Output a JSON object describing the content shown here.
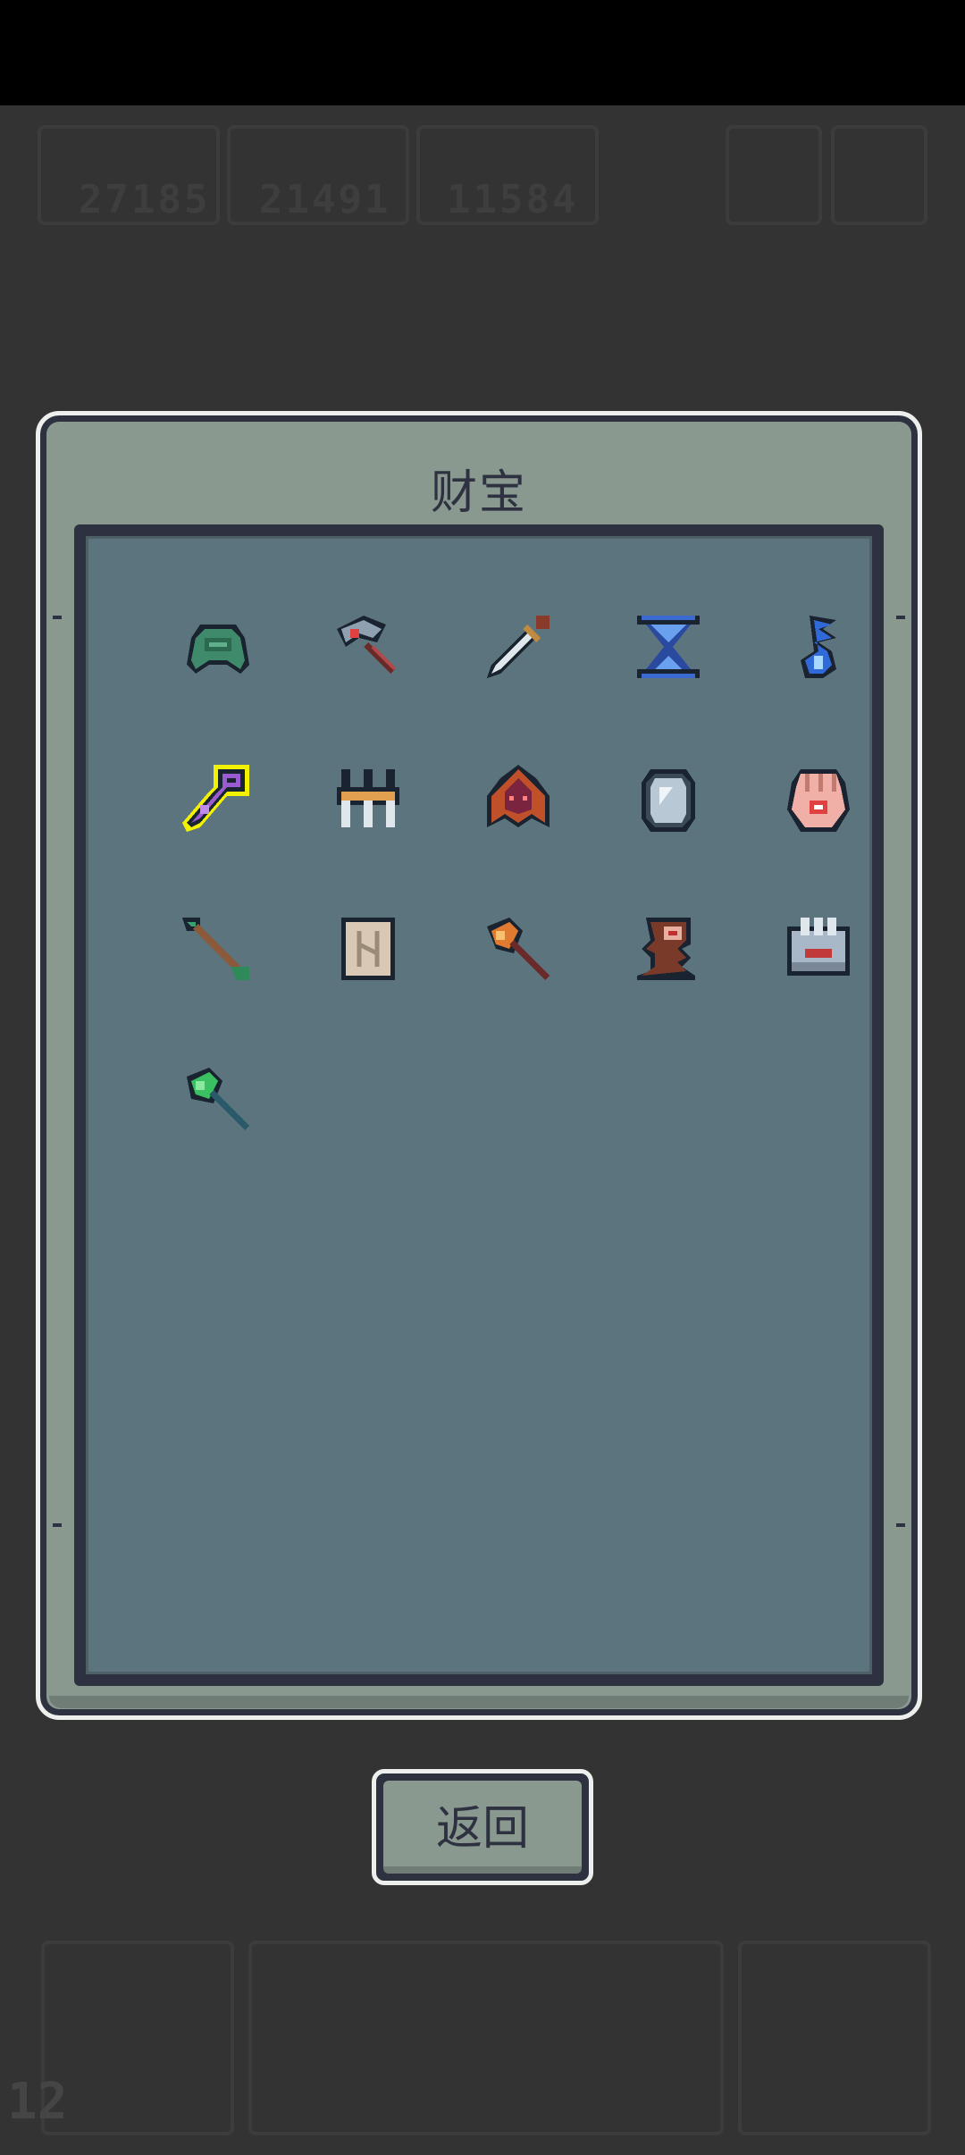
{
  "background_hud": {
    "resources": [
      "27185",
      "21491",
      "11584"
    ],
    "bottom_counter": "12"
  },
  "modal": {
    "title": "财宝"
  },
  "treasures": [
    {
      "icon": "turtle-shell-icon",
      "selected": false
    },
    {
      "icon": "hammer-icon",
      "selected": false
    },
    {
      "icon": "dagger-icon",
      "selected": false
    },
    {
      "icon": "hourglass-icon",
      "selected": false
    },
    {
      "icon": "blue-flame-icon",
      "selected": false
    },
    {
      "icon": "purple-key-icon",
      "selected": true
    },
    {
      "icon": "golden-claws-icon",
      "selected": false
    },
    {
      "icon": "demon-cloak-icon",
      "selected": false
    },
    {
      "icon": "mirror-icon",
      "selected": false
    },
    {
      "icon": "palm-eye-icon",
      "selected": false
    },
    {
      "icon": "arrow-icon",
      "selected": false
    },
    {
      "icon": "rune-scroll-icon",
      "selected": false
    },
    {
      "icon": "fire-axe-icon",
      "selected": false
    },
    {
      "icon": "totem-icon",
      "selected": false
    },
    {
      "icon": "iron-gauntlet-icon",
      "selected": false
    },
    {
      "icon": "green-axe-icon",
      "selected": false
    }
  ],
  "back_button": {
    "label": "返回"
  },
  "colors": {
    "panel_frame": "#2e3240",
    "panel_fill": "#5c747d",
    "modal_fill": "#8a9990",
    "highlight": "#f2f200"
  }
}
